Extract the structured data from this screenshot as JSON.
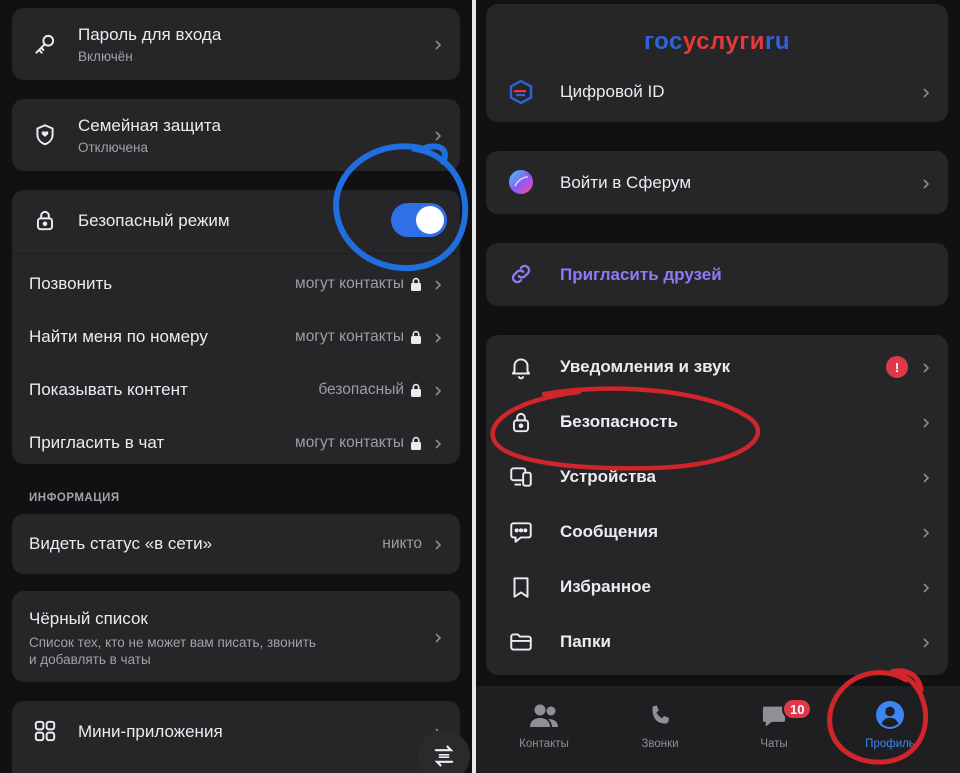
{
  "left": {
    "login_password": {
      "title": "Пароль для входа",
      "status": "Включён",
      "icon": "key-icon"
    },
    "family_protection": {
      "title": "Семейная защита",
      "status": "Отключена",
      "icon": "shield-icon"
    },
    "safe_mode": {
      "title": "Безопасный режим",
      "enabled": true,
      "rows": [
        {
          "label": "Позвонить",
          "value": "могут контакты"
        },
        {
          "label": "Найти меня по номеру",
          "value": "могут контакты"
        },
        {
          "label": "Показывать контент",
          "value": "безопасный"
        },
        {
          "label": "Пригласить в чат",
          "value": "могут контакты"
        }
      ]
    },
    "section_info": "ИНФОРМАЦИЯ",
    "online_status": {
      "label": "Видеть статус «в сети»",
      "value": "никто"
    },
    "blacklist": {
      "title": "Чёрный список",
      "desc_line1": "Список тех, кто не может вам писать, звонить",
      "desc_line2": "и добавлять в чаты"
    },
    "mini_apps": {
      "title": "Мини-приложения"
    }
  },
  "right": {
    "gosuslugi": {
      "part1": "гос",
      "part2": "услуги",
      "part3": "ru"
    },
    "digital_id": "Цифровой ID",
    "sferum": "Войти в Сферум",
    "invite": "Пригласить друзей",
    "settings": [
      {
        "label": "Уведомления и звук",
        "icon": "bell-icon",
        "alert": "!"
      },
      {
        "label": "Безопасность",
        "icon": "lock-icon"
      },
      {
        "label": "Устройства",
        "icon": "devices-icon"
      },
      {
        "label": "Сообщения",
        "icon": "message-icon"
      },
      {
        "label": "Избранное",
        "icon": "bookmark-icon"
      },
      {
        "label": "Папки",
        "icon": "folder-icon"
      }
    ],
    "tabs": [
      {
        "label": "Контакты",
        "icon": "contacts-icon"
      },
      {
        "label": "Звонки",
        "icon": "phone-icon"
      },
      {
        "label": "Чаты",
        "icon": "chat-icon",
        "badge": "10"
      },
      {
        "label": "Профиль",
        "icon": "profile-icon",
        "active": true
      }
    ]
  },
  "colors": {
    "accent": "#2f6fe8",
    "badge": "#e0384b",
    "invite_text": "#8b7cf6",
    "annotation_blue": "#1f6fe0",
    "annotation_red": "#d0252a"
  }
}
